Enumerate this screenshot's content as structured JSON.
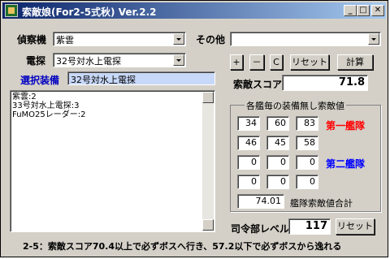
{
  "window": {
    "title": "索敵娘(For2-5式秋) Ver.2.2",
    "minimize": "_",
    "maximize": "□",
    "close": "✕"
  },
  "labels": {
    "reconnaissance": "偵察機",
    "other": "その他",
    "radar": "電探",
    "selected": "選択装備",
    "score": "索敵スコア",
    "hq_level": "司令部レベル"
  },
  "combos": {
    "reconnaissance": "紫雲",
    "other": "",
    "radar": "32号対水上電探"
  },
  "selected_equipment": "32号対水上電探",
  "buttons": {
    "plus": "+",
    "minus": "－",
    "clear": "C",
    "reset": "リセット",
    "calc": "計算",
    "hq_reset": "リセット"
  },
  "score_value": "71.8",
  "equipment_list": [
    "紫雲:2",
    "33号対水上電探:3",
    "FuMO25レーダー:2"
  ],
  "group": {
    "title": "各艦毎の装備無し索敵値",
    "fleet1_label": "第一艦隊",
    "fleet2_label": "第二艦隊",
    "rows": [
      [
        "34",
        "60",
        "83"
      ],
      [
        "46",
        "45",
        "58"
      ],
      [
        "0",
        "0",
        "0"
      ],
      [
        "0",
        "0",
        "0"
      ]
    ],
    "total_value": "74.01",
    "total_label": "艦隊索敵値合計"
  },
  "hq_level": "117",
  "hint_text": "2-5：索敵スコア70.4以上で必ずボスへ行き、57.2以下で必ずボスから逸れる",
  "colors": {
    "fleet1": "#ff0000",
    "fleet2": "#0000ff",
    "selected_label": "#0000c0",
    "selected_bg": "#c8d8f8"
  }
}
